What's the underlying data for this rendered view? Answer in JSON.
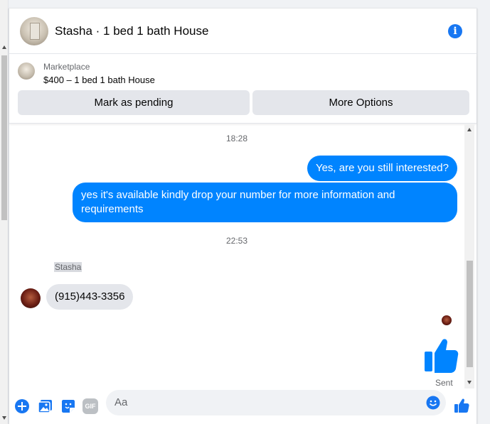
{
  "header": {
    "title": "Stasha · 1 bed 1 bath House",
    "info_icon": "info-icon"
  },
  "marketplace": {
    "label": "Marketplace",
    "listing": "$400 – 1 bed 1 bath House",
    "buttons": {
      "pending": "Mark as pending",
      "more": "More Options"
    }
  },
  "messages": {
    "time_1": "18:28",
    "outgoing_1": "Yes, are you still interested?",
    "outgoing_2": "yes it's available kindly drop your number for more information and requirements",
    "time_2": "22:53",
    "sender": "Stasha",
    "incoming_1": "(915)443-3356",
    "status": "Sent"
  },
  "composer": {
    "placeholder": "Aa",
    "gif_label": "GIF"
  },
  "colors": {
    "accent": "#0084ff",
    "brand_blue": "#1877f2",
    "button_bg": "#e4e6eb"
  }
}
